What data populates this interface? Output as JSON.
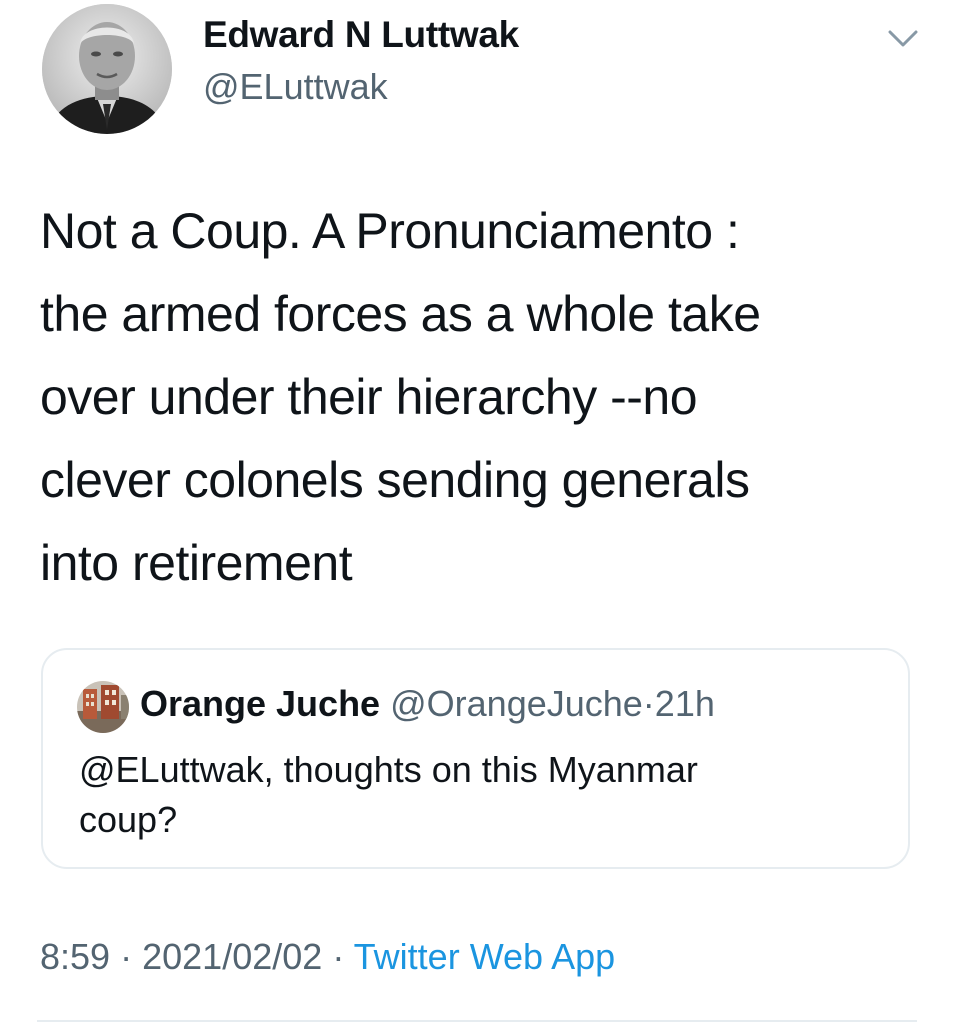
{
  "author": {
    "display_name": "Edward N Luttwak",
    "handle": "@ELuttwak"
  },
  "tweet": {
    "lines": [
      "Not a Coup. A Pronunciamento :",
      "the armed forces as a whole take",
      "over under their hierarchy --no",
      "clever colonels sending generals",
      "into retirement"
    ]
  },
  "quoted_tweet": {
    "display_name": "Orange Juche",
    "handle": "@OrangeJuche",
    "separator": "·",
    "time": "21h",
    "lines": [
      "@ELuttwak, thoughts on this Myanmar",
      "coup?"
    ]
  },
  "meta": {
    "time": "8:59",
    "separator": "·",
    "date": "2021/02/02",
    "separator2": "·",
    "source": "Twitter Web App"
  },
  "icons": {
    "more": "chevron-down-icon",
    "author_avatar": "avatar",
    "quote_avatar": "avatar"
  },
  "colors": {
    "text": "#0f1419",
    "secondary": "#536471",
    "link": "#1b95e0",
    "border": "#e6ecf0"
  }
}
